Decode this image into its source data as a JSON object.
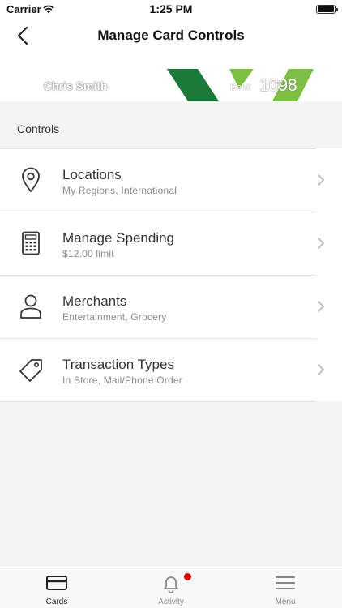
{
  "status_bar": {
    "carrier": "Carrier",
    "time": "1:25 PM"
  },
  "nav": {
    "title": "Manage Card Controls",
    "back_icon": "chevron-left-icon"
  },
  "card": {
    "holder_name": "Chris Smith",
    "type": "Debit",
    "last_four": "1098",
    "colors": {
      "dark_green": "#1b7a3a",
      "light_green": "#7cc043"
    }
  },
  "controls": {
    "header": "Controls",
    "items": [
      {
        "label": "Locations",
        "subtitle": "My Regions, International",
        "icon": "location-pin-icon"
      },
      {
        "label": "Manage Spending",
        "subtitle": "$12.00 limit",
        "icon": "calculator-icon"
      },
      {
        "label": "Merchants",
        "subtitle": "Entertainment, Grocery",
        "icon": "person-icon"
      },
      {
        "label": "Transaction Types",
        "subtitle": "In Store, Mail/Phone Order",
        "icon": "tag-icon"
      }
    ]
  },
  "tab_bar": {
    "tabs": [
      {
        "label": "Cards",
        "icon": "card-icon",
        "active": true
      },
      {
        "label": "Activity",
        "icon": "bell-icon",
        "active": false
      },
      {
        "label": "Menu",
        "icon": "hamburger-icon",
        "active": false
      }
    ],
    "badge_color": "#e10000"
  }
}
